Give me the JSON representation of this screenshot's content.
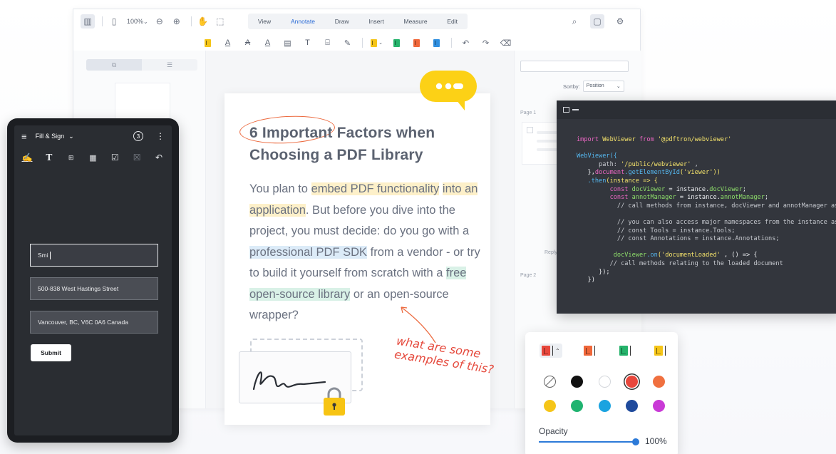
{
  "viewer": {
    "zoom": "100%",
    "tabs": [
      {
        "label": "View"
      },
      {
        "label": "Annotate"
      },
      {
        "label": "Draw"
      },
      {
        "label": "Insert"
      },
      {
        "label": "Measure"
      },
      {
        "label": "Edit"
      }
    ],
    "active_tab": "Annotate",
    "sort_label": "Sortby:",
    "sort_value": "Position",
    "page1_label": "Page 1",
    "page2_label": "Page 2",
    "reply_label": "Reply"
  },
  "document": {
    "title_line1": "6 Important Factors when",
    "title_line2": "Choosing a PDF Library",
    "body": {
      "s1": "You plan to ",
      "h1": "embed PDF functionality",
      "s2": "into an application",
      "s3": ". But before you dive into the project, you must decide: do you go with a ",
      "h2": "professional PDF SDK",
      "s4": " from a vendor - or try to build it yourself from scratch with a ",
      "h3": "free open-source library",
      "s5": " or an open-source wrapper?"
    },
    "handwritten_note_line1": "what are some",
    "handwritten_note_line2": "examples of this?"
  },
  "code": {
    "l1_kw": "import",
    "l1_name": " WebViewer",
    "l1_from": " from",
    "l1_str": " '@pdftron/webviewer'",
    "l2": "WebViewer({",
    "l3_key": "      path:",
    "l3_val": " '/public/webviewer'",
    "l3_end": " ,",
    "l4_a": "   },",
    "l4_b": "document",
    "l4_c": ".getElementById",
    "l4_d": "('viewer'))",
    "l5_a": "   .then",
    "l5_b": "(instance => {",
    "l6_a": "         const",
    "l6_b": " docViewer",
    "l6_c": " = instance.",
    "l6_d": "docViewer",
    "l6_e": ";",
    "l7_a": "         const",
    "l7_b": " annotManager",
    "l7_c": " = instance.",
    "l7_d": "annotManager",
    "l7_e": ";",
    "l8": "           // call methods from instance, docViewer and annotManager as needed",
    "l9": "           // you can also access major namespaces from the instance as follows:",
    "l10": "           // const Tools = instance.Tools;",
    "l11": "           // const Annotations = instance.Annotations;",
    "l12_a": "          docViewer",
    "l12_b": ".on",
    "l12_c": "('documentLoaded'",
    "l12_d": " , () => {",
    "l13": "         // call methods relating to the loaded document",
    "l14": "      });",
    "l15": "   })"
  },
  "phone": {
    "title": "Fill & Sign",
    "count": "3",
    "field_name": "Smi",
    "field_street": "500-838 West Hastings Street",
    "field_city": "Vancouver, BC, V6C 0A6 Canada",
    "submit_label": "Submit"
  },
  "picker": {
    "opacity_label": "Opacity",
    "opacity_value": "100%",
    "opacity": 1.0,
    "styles": [
      {
        "color": "#e8473c"
      },
      {
        "color": "#f0673a"
      },
      {
        "color": "#25b36b"
      },
      {
        "color": "#f5c518"
      }
    ],
    "swatches": [
      {
        "name": "transparent",
        "color": "none"
      },
      {
        "name": "black",
        "color": "#111111"
      },
      {
        "name": "white",
        "color": "#ffffff"
      },
      {
        "name": "red",
        "color": "#e8473c"
      },
      {
        "name": "orange",
        "color": "#f0703f"
      },
      {
        "name": "yellow",
        "color": "#f5c518"
      },
      {
        "name": "green",
        "color": "#1fb370"
      },
      {
        "name": "sky-blue",
        "color": "#1aa3e0"
      },
      {
        "name": "navy",
        "color": "#1f4a9c"
      },
      {
        "name": "magenta",
        "color": "#c93ad6"
      }
    ],
    "selected_swatch": "red"
  },
  "colors": {
    "accent": "#2c6cd6",
    "annotation_red": "#ec6a3f",
    "speech_bubble": "#fcd116",
    "code_bg": "#33363d"
  }
}
